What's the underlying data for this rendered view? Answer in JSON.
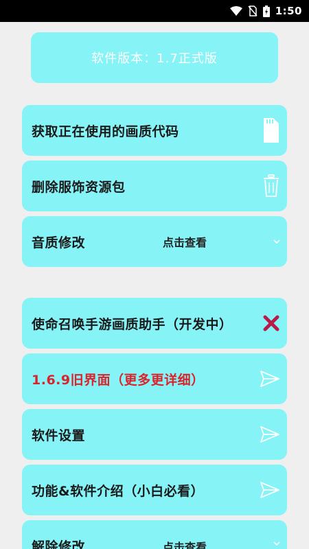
{
  "status_bar": {
    "time": "1:50"
  },
  "version_card": {
    "text": "软件版本：1.7正式版"
  },
  "menu": [
    {
      "label": "获取正在使用的画质代码",
      "icon": "sd-card-icon"
    },
    {
      "label": "删除服饰资源包",
      "icon": "trash-icon"
    },
    {
      "label": "音质修改",
      "value": "点击查看",
      "icon": "chevron-down-icon"
    },
    {
      "label": "使命召唤手游画质助手（开发中）",
      "icon": "close-icon"
    },
    {
      "label": "1.6.9旧界面（更多更详细）",
      "icon": "send-icon",
      "color": "#d8242c"
    },
    {
      "label": "软件设置",
      "icon": "send-icon"
    },
    {
      "label": "功能&软件介绍（小白必看）",
      "icon": "send-icon"
    },
    {
      "label": "解除修改",
      "value": "点击查看",
      "icon": "chevron-down-icon"
    }
  ]
}
